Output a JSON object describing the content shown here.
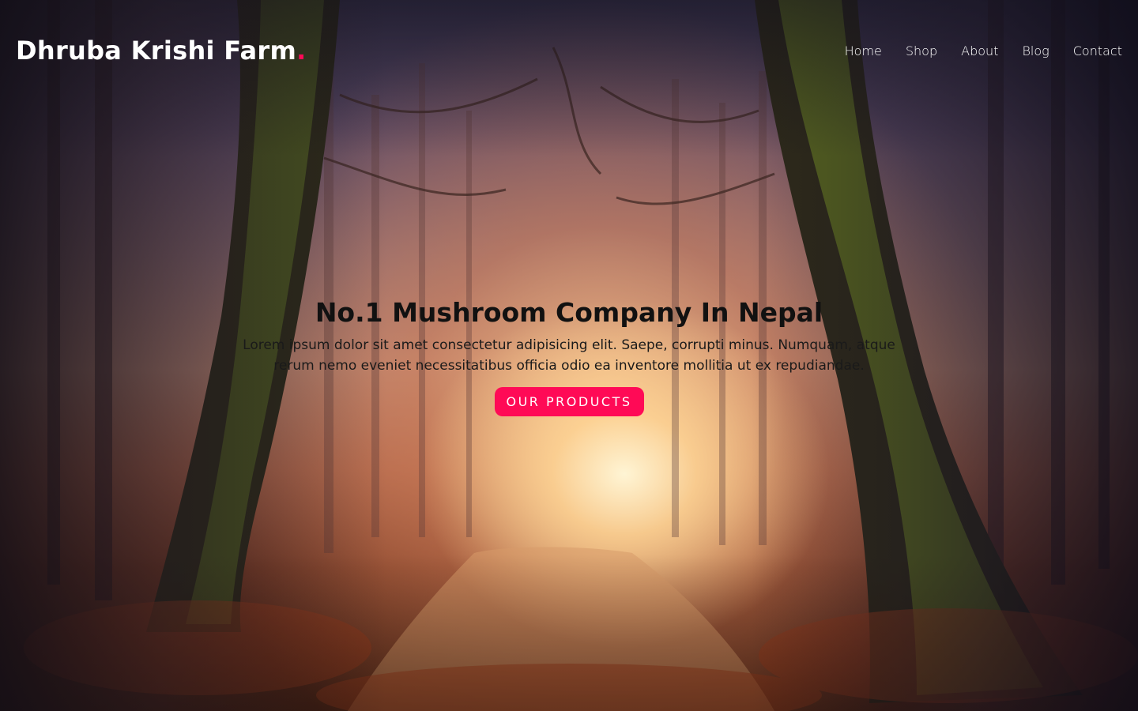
{
  "brand": {
    "name": "Dhruba Krishi Farm",
    "dot": "."
  },
  "nav": {
    "items": [
      {
        "label": "Home"
      },
      {
        "label": "Shop"
      },
      {
        "label": "About"
      },
      {
        "label": "Blog"
      },
      {
        "label": "Contact"
      }
    ]
  },
  "hero": {
    "title": "No.1 Mushroom Company In Nepal",
    "text": "Lorem ipsum dolor sit amet consectetur adipisicing elit. Saepe, corrupti minus. Numquam, atque rerum nemo eveniet necessitatibus officia odio ea inventore mollitia ut ex repudiandae.",
    "cta_label": "OUR PRODUCTS"
  },
  "colors": {
    "accent": "#ff0a56",
    "text_light": "#ffffff",
    "text_dark": "#111111"
  },
  "background": {
    "image": "forest-path-background"
  }
}
